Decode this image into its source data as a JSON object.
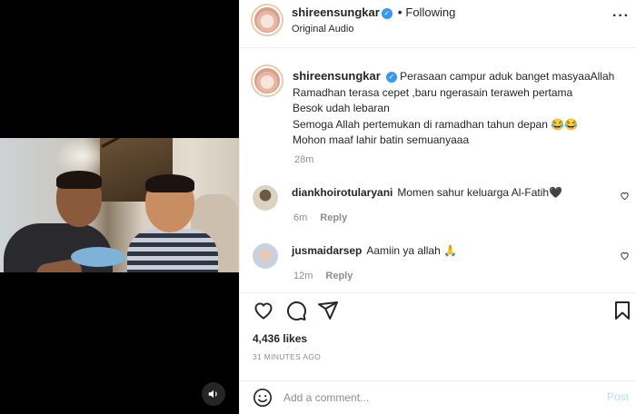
{
  "header": {
    "username": "shireensungkar",
    "follow_status": "Following",
    "audio": "Original Audio",
    "more_icon": "more-horizontal-icon"
  },
  "caption": {
    "username": "shireensungkar",
    "lines": [
      "Perasaan campur aduk banget masyaaAllah",
      "Ramadhan terasa cepet ,baru ngerasain teraweh pertama",
      "Besok udah lebaran",
      "Semoga Allah pertemukan di ramadhan tahun depan 😂😂",
      "Mohon maaf lahir batin semuanyaaa"
    ],
    "time": "28m"
  },
  "comments": [
    {
      "username": "diankhoirotularyani",
      "text": "Momen sahur keluarga Al-Fatih🖤",
      "time": "6m",
      "reply_label": "Reply"
    },
    {
      "username": "jusmaidarsep",
      "text": "Aamiin ya allah 🙏",
      "time": "12m",
      "reply_label": "Reply"
    }
  ],
  "stats": {
    "likes": "4,436 likes",
    "posted": "31 MINUTES AGO"
  },
  "composer": {
    "placeholder": "Add a comment...",
    "post_label": "Post"
  },
  "icons": {
    "like": "heart-icon",
    "comment": "comment-icon",
    "share": "send-icon",
    "save": "bookmark-icon",
    "emoji": "emoji-icon",
    "mute": "speaker-icon"
  },
  "colors": {
    "verified": "#3897f0",
    "post_button": "#b2dffc",
    "meta_gray": "#8e8e8e"
  }
}
